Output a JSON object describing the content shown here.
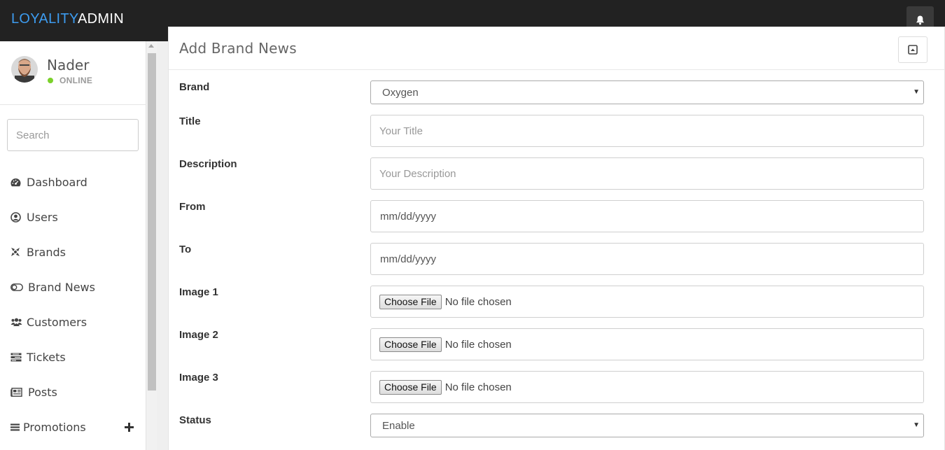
{
  "app": {
    "logo_part1": "LOYALITY",
    "logo_part2": "ADMIN",
    "accent": "#3d9cf0",
    "topbar_color": "#222222"
  },
  "user": {
    "name": "Nader",
    "status": "ONLINE",
    "status_color": "#7bd12b"
  },
  "search": {
    "placeholder": "Search"
  },
  "nav": [
    {
      "label": "Dashboard",
      "icon": "dashboard-icon"
    },
    {
      "label": "Users",
      "icon": "user-circle-icon"
    },
    {
      "label": "Brands",
      "icon": "brands-icon"
    },
    {
      "label": "Brand News",
      "icon": "toggle-icon"
    },
    {
      "label": "Customers",
      "icon": "users-icon"
    },
    {
      "label": "Tickets",
      "icon": "tickets-icon"
    },
    {
      "label": "Posts",
      "icon": "newspaper-icon"
    },
    {
      "label": "Promotions",
      "icon": "bars-icon",
      "expand_icon": "plus-icon"
    }
  ],
  "panel": {
    "title": "Add Brand News"
  },
  "form": {
    "brand": {
      "label": "Brand",
      "value": "Oxygen"
    },
    "title": {
      "label": "Title",
      "placeholder": "Your Title"
    },
    "description": {
      "label": "Description",
      "placeholder": "Your Description"
    },
    "from": {
      "label": "From",
      "value": "mm/dd/yyyy"
    },
    "to": {
      "label": "To",
      "value": "mm/dd/yyyy"
    },
    "image1": {
      "label": "Image 1",
      "button": "Choose File",
      "status": "No file chosen"
    },
    "image2": {
      "label": "Image 2",
      "button": "Choose File",
      "status": "No file chosen"
    },
    "image3": {
      "label": "Image 3",
      "button": "Choose File",
      "status": "No file chosen"
    },
    "status": {
      "label": "Status",
      "value": "Enable"
    }
  }
}
